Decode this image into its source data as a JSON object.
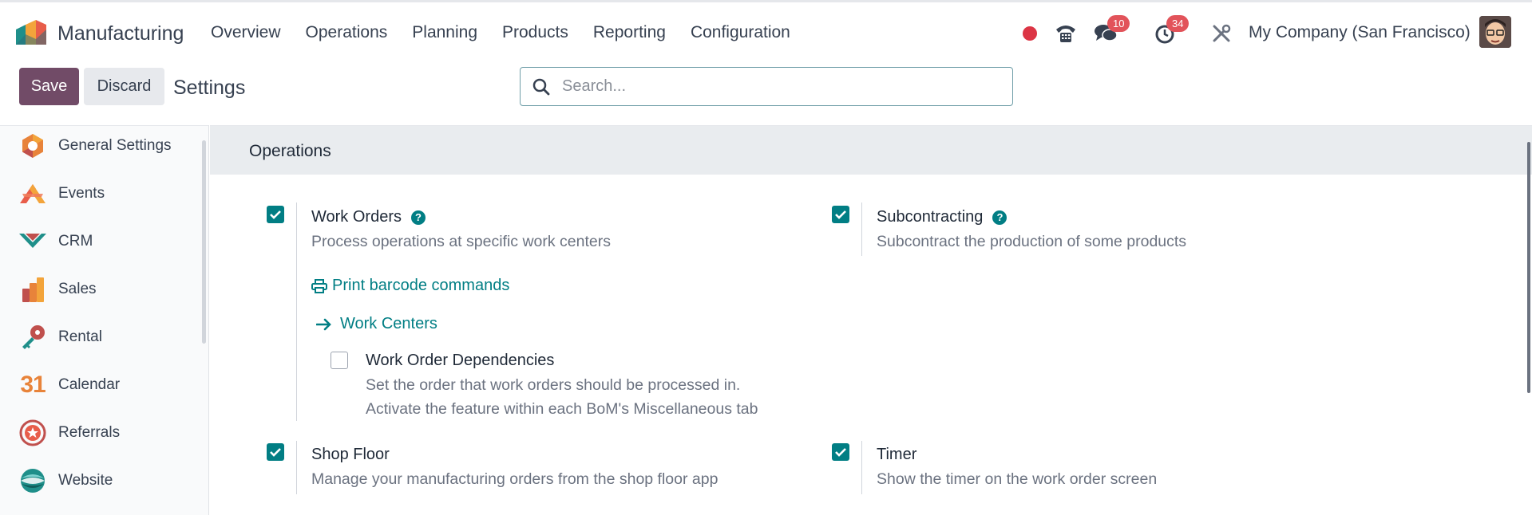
{
  "app": {
    "name": "Manufacturing"
  },
  "menu": [
    "Overview",
    "Operations",
    "Planning",
    "Products",
    "Reporting",
    "Configuration"
  ],
  "systray": {
    "messages_count": "10",
    "activities_count": "34",
    "company": "My Company (San Francisco)"
  },
  "control_panel": {
    "save_label": "Save",
    "discard_label": "Discard",
    "title": "Settings",
    "search_placeholder": "Search..."
  },
  "sidebar": {
    "items": [
      {
        "label": "General Settings",
        "icon": "general-settings-icon"
      },
      {
        "label": "Events",
        "icon": "events-icon"
      },
      {
        "label": "CRM",
        "icon": "crm-icon"
      },
      {
        "label": "Sales",
        "icon": "sales-icon"
      },
      {
        "label": "Rental",
        "icon": "rental-icon"
      },
      {
        "label": "Calendar",
        "icon": "calendar-icon",
        "glyph": "31"
      },
      {
        "label": "Referrals",
        "icon": "referrals-icon"
      },
      {
        "label": "Website",
        "icon": "website-icon"
      }
    ]
  },
  "section": {
    "title": "Operations",
    "options": {
      "work_orders": {
        "title": "Work Orders",
        "desc": "Process operations at specific work centers",
        "checked": true
      },
      "subcontracting": {
        "title": "Subcontracting",
        "desc": "Subcontract the production of some products",
        "checked": true
      },
      "print_barcode": "Print barcode commands",
      "work_centers": "Work Centers",
      "work_order_dependencies": {
        "title": "Work Order Dependencies",
        "desc_line1": "Set the order that work orders should be processed in.",
        "desc_line2": "Activate the feature within each BoM's Miscellaneous tab",
        "checked": false
      },
      "shop_floor": {
        "title": "Shop Floor",
        "desc": "Manage your manufacturing orders from the shop floor app",
        "checked": true
      },
      "timer": {
        "title": "Timer",
        "desc": "Show the timer on the work order screen",
        "checked": true
      }
    }
  },
  "colors": {
    "primary": "#714b67",
    "accent": "#017e84",
    "badge": "#e2535a",
    "recording": "#dc3545"
  }
}
